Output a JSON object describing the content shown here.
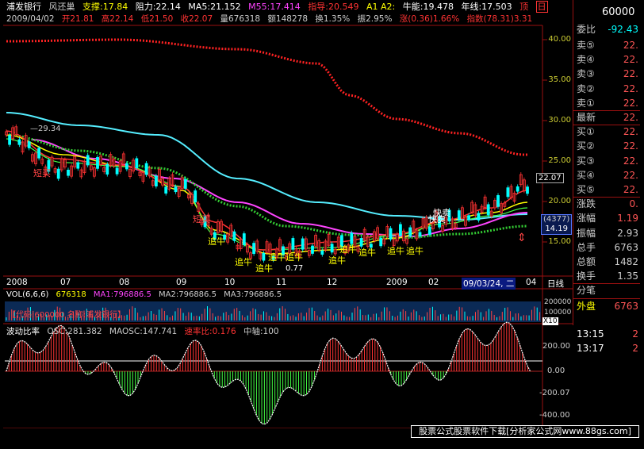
{
  "header1": {
    "stock_name": "浦发银行",
    "restore": "风还巢",
    "support": "支撑:17.84",
    "resistance": "阻力:22.14",
    "ma5": "MA5:21.152",
    "m55": "M55:17.414",
    "guide": "指导:20.549",
    "a1a2": "A1  A2:",
    "bull": "牛能:19.478",
    "year_line": "年线:17.503",
    "top": "顶",
    "top_btn": "日"
  },
  "header2": {
    "date": "2009/04/02",
    "open": "开21.81",
    "high": "高22.14",
    "low": "低21.50",
    "close": "收22.07",
    "volume": "量676318",
    "amount": "额148278",
    "turnover": "换1.35%",
    "amplitude": "振2.95%",
    "change": "涨(0.36)1.66%",
    "index": "指数(78.31)3.31"
  },
  "right_panel": {
    "code": "60000",
    "ratio_label": "委比",
    "ratio_value": "-92.43",
    "rows": [
      {
        "label": "卖⑤",
        "value": "22."
      },
      {
        "label": "卖④",
        "value": "22."
      },
      {
        "label": "卖③",
        "value": "22."
      },
      {
        "label": "卖②",
        "value": "22."
      },
      {
        "label": "卖①",
        "value": "22."
      },
      {
        "label": "最新",
        "value": "22."
      },
      {
        "label": "买①",
        "value": "22."
      },
      {
        "label": "买②",
        "value": "22."
      },
      {
        "label": "买③",
        "value": "22."
      },
      {
        "label": "买④",
        "value": "22."
      },
      {
        "label": "买⑤",
        "value": "22."
      },
      {
        "label": "涨跌",
        "value": "0."
      },
      {
        "label": "涨幅",
        "value": "1.19"
      },
      {
        "label": "振幅",
        "value": "2.93"
      },
      {
        "label": "总手",
        "value": "6763"
      },
      {
        "label": "总额",
        "value": "1482"
      },
      {
        "label": "换手",
        "value": "1.35"
      },
      {
        "label": "分笔",
        "value": ""
      },
      {
        "label": "外盘",
        "value": "6763"
      }
    ],
    "ticks": [
      {
        "time": "13:15",
        "value": "2"
      },
      {
        "time": "13:17",
        "value": "2"
      }
    ]
  },
  "price_axis": [
    "40.00",
    "35.00",
    "30.00",
    "25.00",
    "20.00",
    "15.00"
  ],
  "price_labels": {
    "current": "22.07",
    "count": "(4377)",
    "low": "14.19",
    "peak": "29.34",
    "low_annot": "0.77"
  },
  "annotations": [
    "短买",
    "短买",
    "追牛",
    "追牛",
    "追牛",
    "追牛",
    "追牛",
    "追牛",
    "追牛",
    "追牛",
    "追牛",
    "追牛",
    "快卖",
    "快卖"
  ],
  "time_axis": [
    "2008",
    "07",
    "08",
    "09",
    "10",
    "11",
    "12",
    "2009",
    "02",
    "09/03/24, 二",
    "04",
    "日线"
  ],
  "volume": {
    "label": "VOL(6,6,6)",
    "val": "676318",
    "ma1": "MA1:796886.5",
    "ma2": "MA2:796886.5",
    "ma3": "MA3:796886.5",
    "code_line": "【代码:600000  名称:浦发银行】",
    "axis": [
      "200000",
      "100000"
    ],
    "unit": "X10"
  },
  "osc": {
    "title": "波动比率",
    "osc": "OSC:281.382",
    "maosc": "MAOSC:147.741",
    "speed": "速率比:0.176",
    "axis_label": "中轴:100",
    "axis": [
      "200.00",
      "0.00",
      "-200.07",
      "-400.00"
    ]
  },
  "footer": "股票公式股票软件下载[分析家公式网www.88gs.com]",
  "colors": {
    "up": "#ff3333",
    "down": "#00ffff",
    "ma_yellow": "#ffff00",
    "ma_magenta": "#ff44ff",
    "ma_cyan": "#55eeff",
    "ma_green": "#33cc33",
    "year_red": "#ff2222"
  }
}
